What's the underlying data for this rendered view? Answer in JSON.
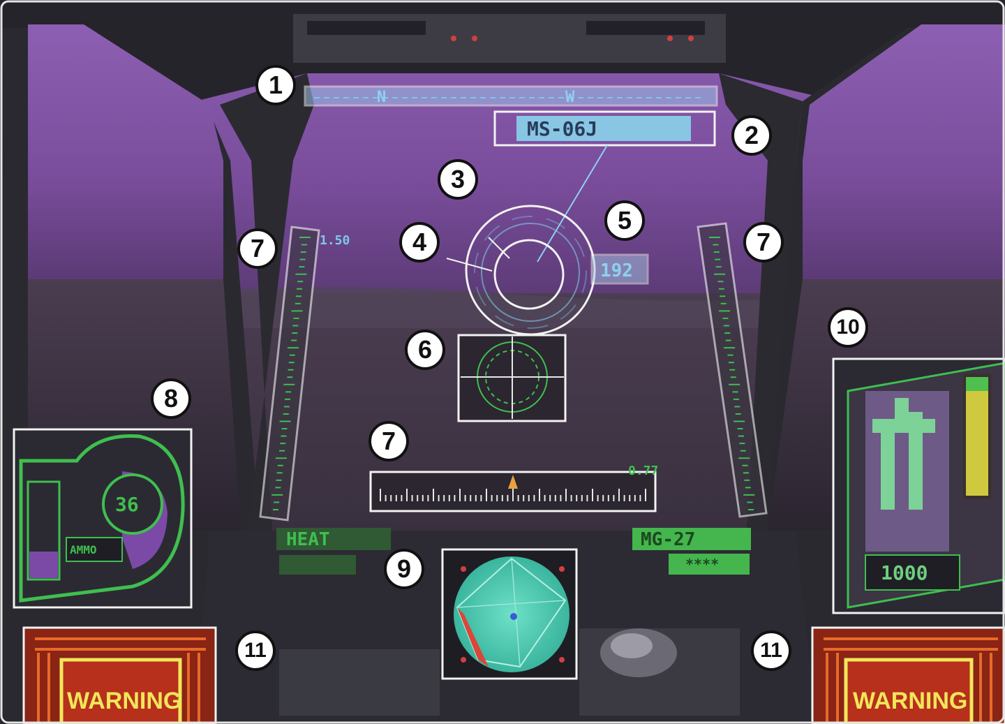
{
  "hud": {
    "compass": {
      "north": "N",
      "west": "W"
    },
    "target_id": "MS-06J",
    "distance": "192",
    "left_gauge_value": "1.50",
    "bottom_gauge_value": "0.77",
    "weapon_left": "HEAT",
    "weapon_right": "MG-27",
    "weapon_right_sub": "****",
    "left_panel_value": "36",
    "left_panel_tag": "AMMO",
    "right_panel_value": "1000",
    "warning_left": "WARNING",
    "warning_right": "WARNING"
  },
  "callouts": [
    "1",
    "2",
    "3",
    "4",
    "5",
    "6",
    "7",
    "7",
    "7",
    "8",
    "9",
    "10",
    "11",
    "11"
  ],
  "colors": {
    "sky": "#7c4f9e",
    "ground": "#3a3340",
    "frame": "#24232a",
    "hud_blue": "#7fc7e8",
    "hud_green": "#3fbf4f",
    "warning_red": "#c8301c",
    "warning_yellow": "#f2e65a"
  }
}
